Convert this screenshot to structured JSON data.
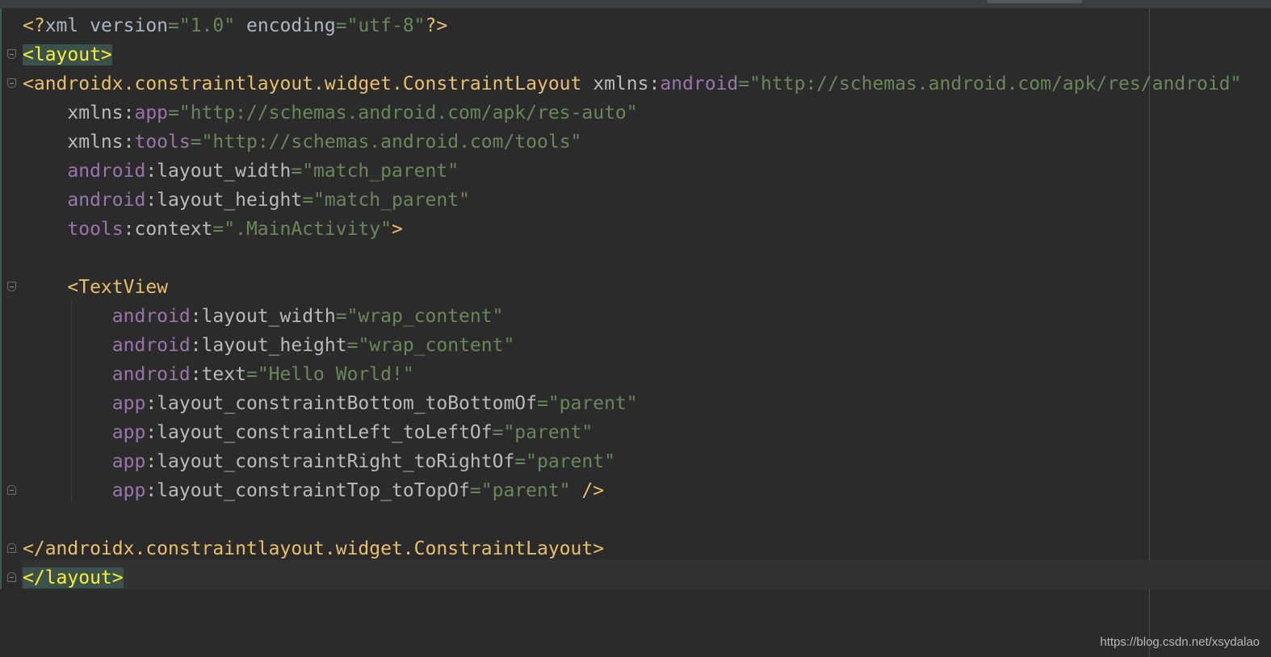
{
  "editor": {
    "lines": [
      {
        "fold": null,
        "tokens": [
          {
            "t": "<?",
            "c": "tag"
          },
          {
            "t": "xml version",
            "c": "txt"
          },
          {
            "t": "=\"1.0\"",
            "c": "val"
          },
          {
            "t": " encoding",
            "c": "txt"
          },
          {
            "t": "=\"utf-8\"",
            "c": "val"
          },
          {
            "t": "?>",
            "c": "tag"
          }
        ]
      },
      {
        "fold": "open",
        "tokens": [
          {
            "t": "<layout>",
            "c": "hl"
          }
        ]
      },
      {
        "fold": "open",
        "tokens": [
          {
            "t": "<androidx.constraintlayout.widget.ConstraintLayout ",
            "c": "tag"
          },
          {
            "t": "xmlns:",
            "c": "attr"
          },
          {
            "t": "android",
            "c": "ns"
          },
          {
            "t": "=\"http://schemas.android.com/apk/res/android\"",
            "c": "val"
          }
        ]
      },
      {
        "fold": null,
        "tokens": [
          {
            "t": "    xmlns:",
            "c": "attr"
          },
          {
            "t": "app",
            "c": "ns"
          },
          {
            "t": "=\"http://schemas.android.com/apk/res-auto\"",
            "c": "val"
          }
        ]
      },
      {
        "fold": null,
        "tokens": [
          {
            "t": "    xmlns:",
            "c": "attr"
          },
          {
            "t": "tools",
            "c": "ns"
          },
          {
            "t": "=\"http://schemas.android.com/tools\"",
            "c": "val"
          }
        ]
      },
      {
        "fold": null,
        "tokens": [
          {
            "t": "    android",
            "c": "ns"
          },
          {
            "t": ":layout_width",
            "c": "attr"
          },
          {
            "t": "=\"match_parent\"",
            "c": "val"
          }
        ]
      },
      {
        "fold": null,
        "tokens": [
          {
            "t": "    android",
            "c": "ns"
          },
          {
            "t": ":layout_height",
            "c": "attr"
          },
          {
            "t": "=\"match_parent\"",
            "c": "val"
          }
        ]
      },
      {
        "fold": null,
        "tokens": [
          {
            "t": "    tools",
            "c": "ns"
          },
          {
            "t": ":context",
            "c": "attr"
          },
          {
            "t": "=\".MainActivity\"",
            "c": "val"
          },
          {
            "t": ">",
            "c": "tag"
          }
        ]
      },
      {
        "fold": null,
        "tokens": []
      },
      {
        "fold": "open",
        "tokens": [
          {
            "t": "    <TextView",
            "c": "tag"
          }
        ]
      },
      {
        "fold": null,
        "tokens": [
          {
            "t": "        android",
            "c": "ns"
          },
          {
            "t": ":layout_width",
            "c": "attr"
          },
          {
            "t": "=\"wrap_content\"",
            "c": "val"
          }
        ]
      },
      {
        "fold": null,
        "tokens": [
          {
            "t": "        android",
            "c": "ns"
          },
          {
            "t": ":layout_height",
            "c": "attr"
          },
          {
            "t": "=\"wrap_content\"",
            "c": "val"
          }
        ]
      },
      {
        "fold": null,
        "tokens": [
          {
            "t": "        android",
            "c": "ns"
          },
          {
            "t": ":text",
            "c": "attr"
          },
          {
            "t": "=\"Hello World!\"",
            "c": "val"
          }
        ]
      },
      {
        "fold": null,
        "tokens": [
          {
            "t": "        app",
            "c": "ns"
          },
          {
            "t": ":layout_constraintBottom_toBottomOf",
            "c": "attr"
          },
          {
            "t": "=\"parent\"",
            "c": "val"
          }
        ]
      },
      {
        "fold": null,
        "tokens": [
          {
            "t": "        app",
            "c": "ns"
          },
          {
            "t": ":layout_constraintLeft_toLeftOf",
            "c": "attr"
          },
          {
            "t": "=\"parent\"",
            "c": "val"
          }
        ]
      },
      {
        "fold": null,
        "tokens": [
          {
            "t": "        app",
            "c": "ns"
          },
          {
            "t": ":layout_constraintRight_toRightOf",
            "c": "attr"
          },
          {
            "t": "=\"parent\"",
            "c": "val"
          }
        ]
      },
      {
        "fold": "close",
        "tokens": [
          {
            "t": "        app",
            "c": "ns"
          },
          {
            "t": ":layout_constraintTop_toTopOf",
            "c": "attr"
          },
          {
            "t": "=\"parent\"",
            "c": "val"
          },
          {
            "t": " />",
            "c": "tag"
          }
        ]
      },
      {
        "fold": null,
        "tokens": []
      },
      {
        "fold": "close",
        "tokens": [
          {
            "t": "</androidx.constraintlayout.widget.ConstraintLayout>",
            "c": "tag"
          }
        ]
      },
      {
        "fold": "close",
        "tokens": [
          {
            "t": "</layout>",
            "c": "hl"
          }
        ]
      }
    ]
  },
  "watermark": "https://blog.csdn.net/xsydalao",
  "colors": {
    "background": "#2b2b2b",
    "tag": "#e8bf6a",
    "namespace": "#9876aa",
    "attribute": "#bababa",
    "value": "#6a8759",
    "highlight_bg": "#3b514d",
    "highlight_fg": "#ffef28"
  }
}
